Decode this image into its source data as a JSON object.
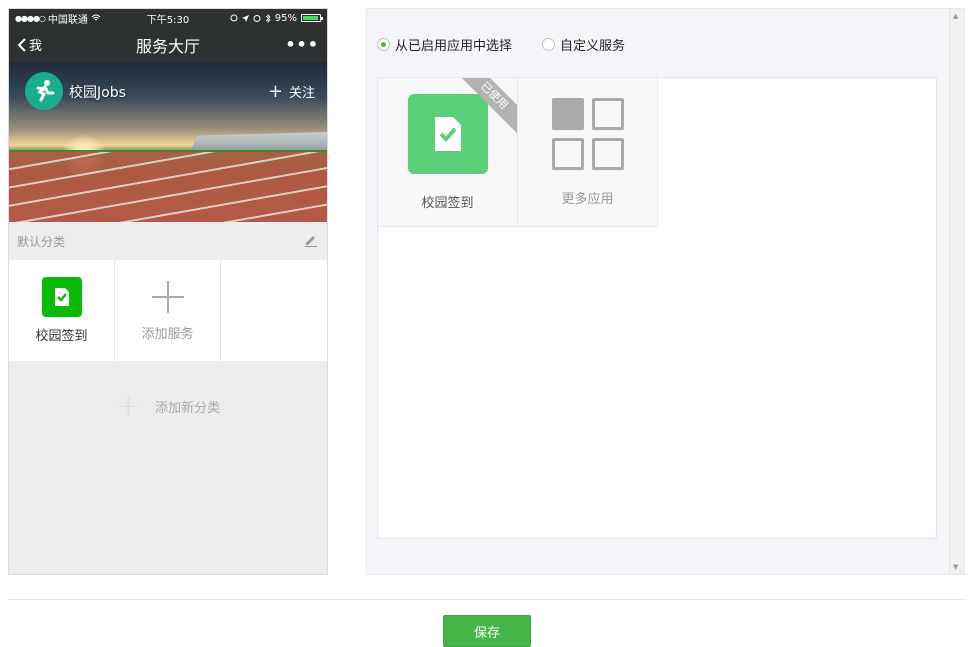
{
  "phone": {
    "status": {
      "signal": "●●●●○",
      "carrier": "中国联通",
      "time": "下午5:30",
      "battery": "95%",
      "battery_level": 0.95
    },
    "nav": {
      "back": "我",
      "title": "服务大厅",
      "more": "•••"
    },
    "banner": {
      "brand": "校园Jobs",
      "follow": "关注",
      "follow_icon": "plus-icon"
    },
    "category": {
      "name": "默认分类",
      "items": [
        {
          "label": "校园签到"
        },
        {
          "label": "添加服务"
        }
      ],
      "add_new": "添加新分类"
    }
  },
  "panel": {
    "options": [
      {
        "label": "从已启用应用中选择",
        "selected": true
      },
      {
        "label": "自定义服务",
        "selected": false
      }
    ],
    "apps": [
      {
        "label": "校园签到",
        "badge": "已使用"
      },
      {
        "label": "更多应用"
      }
    ]
  },
  "footer": {
    "save": "保存"
  },
  "colors": {
    "accent": "#44b549",
    "nav_bg": "#2e3132",
    "app_green": "#09bb07"
  }
}
